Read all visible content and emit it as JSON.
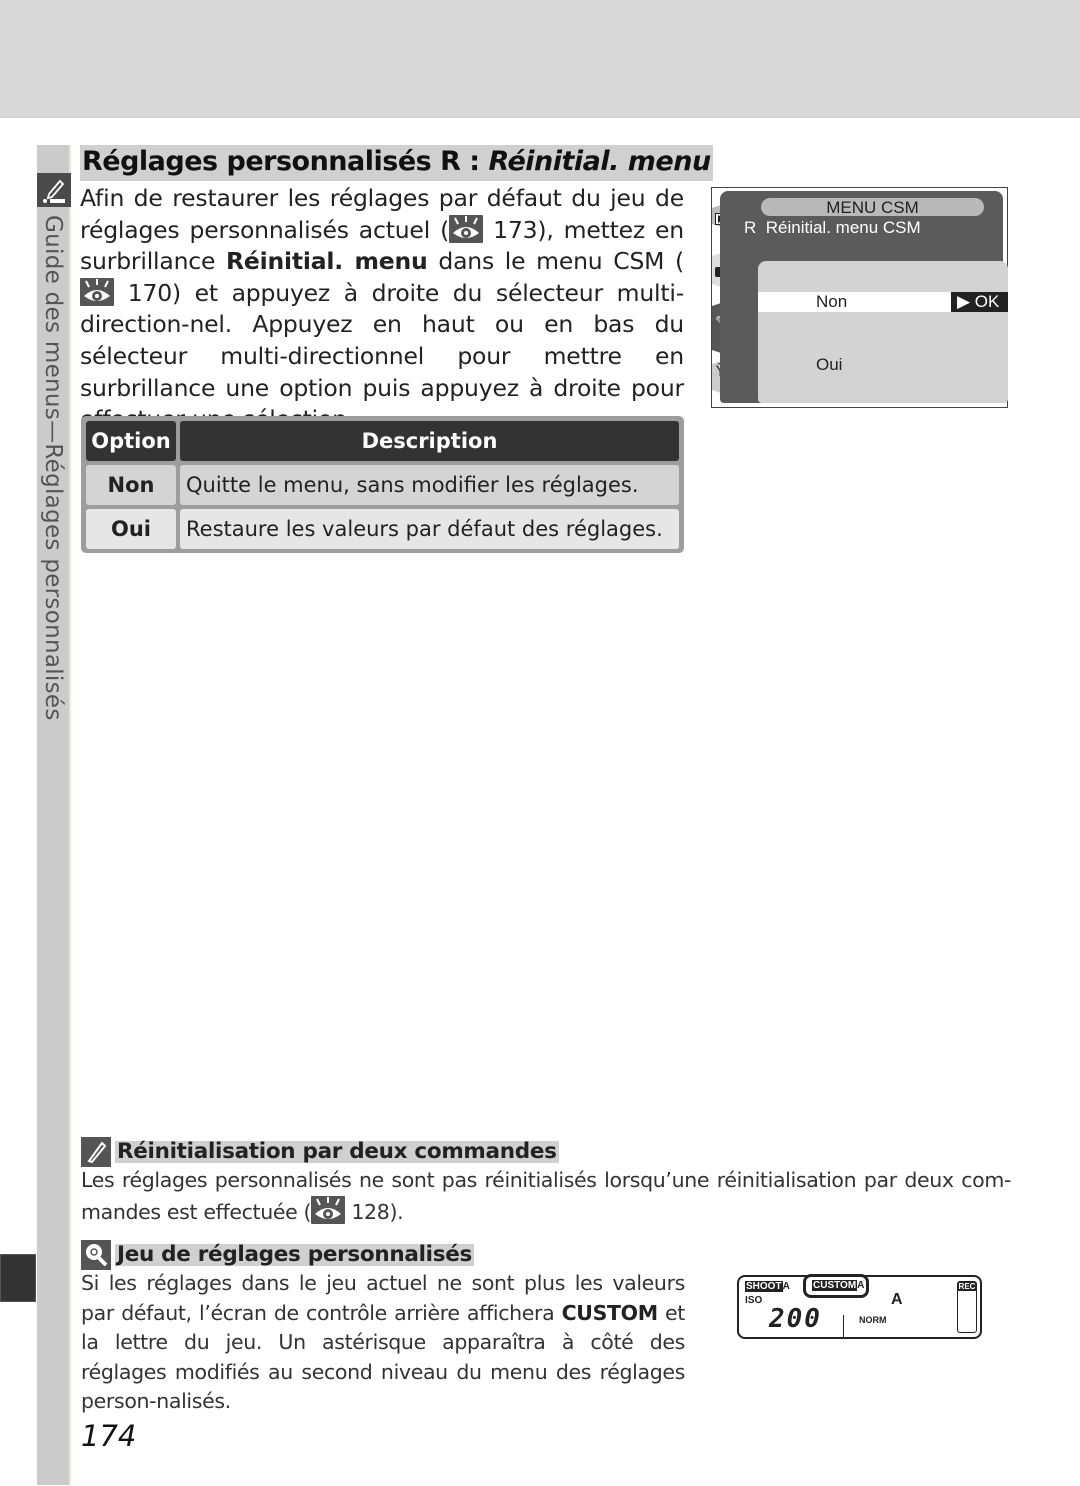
{
  "page": {
    "title_prefix": "Réglages personnalisés R : ",
    "title_italic": "Réinitial. menu",
    "side_label": "Guide des menus—Réglages personnalisés",
    "intro": {
      "part1": "Afin de restaurer les réglages par défaut du jeu de réglages personnalisés actuel (",
      "ref1": " 173), mettez en surbrillance ",
      "bold": "Réinitial. menu",
      "part2": " dans le menu CSM (",
      "ref2": " 170) et appuyez à droite du sélecteur multi-direction-nel. Appuyez en haut ou en bas du sélecteur multi-directionnel pour mettre en surbrillance une option puis appuyez à droite pour effectuer une sélection."
    },
    "table": {
      "headers": [
        "Option",
        "Description"
      ],
      "rows": [
        {
          "option": "Non",
          "description": "Quitte le menu, sans modifier les réglages."
        },
        {
          "option": "Oui",
          "description": "Restaure les valeurs par défaut des réglages."
        }
      ]
    },
    "camera_screen": {
      "menu_title": "MENU CSM",
      "item_code": "R",
      "item_label": "Réinitial. menu CSM",
      "options": [
        "Non",
        "Oui"
      ],
      "selected_option": "Non",
      "ok_label": "▶ OK",
      "sidebar_icons": [
        "playback-icon",
        "camera-icon",
        "pencil-icon",
        "wrench-icon"
      ]
    },
    "note1": {
      "heading": "Réinitialisation par deux commandes",
      "text_before": "Les réglages personnalisés ne sont pas réinitialisés lorsqu’une réinitialisation par deux com-mandes est effectuée (",
      "text_after": " 128)."
    },
    "note2": {
      "heading": "Jeu de réglages personnalisés",
      "text_before": "Si les réglages dans le jeu actuel ne sont plus les valeurs par défaut, l’écran de contrôle arrière affichera ",
      "bold": "CUSTOM",
      "text_after": " et la lettre du jeu. Un astérisque apparaîtra à côté des réglages modifiés au second niveau du menu des réglages person-nalisés."
    },
    "lcd": {
      "shoot": "SHOOT",
      "shoot_bank": "A",
      "custom": "CUSTOM",
      "custom_bank": "A",
      "iso_label": "ISO",
      "iso_value": "200",
      "quality": "NORM",
      "wb": "A",
      "rec": "REC"
    },
    "page_number": "174"
  }
}
